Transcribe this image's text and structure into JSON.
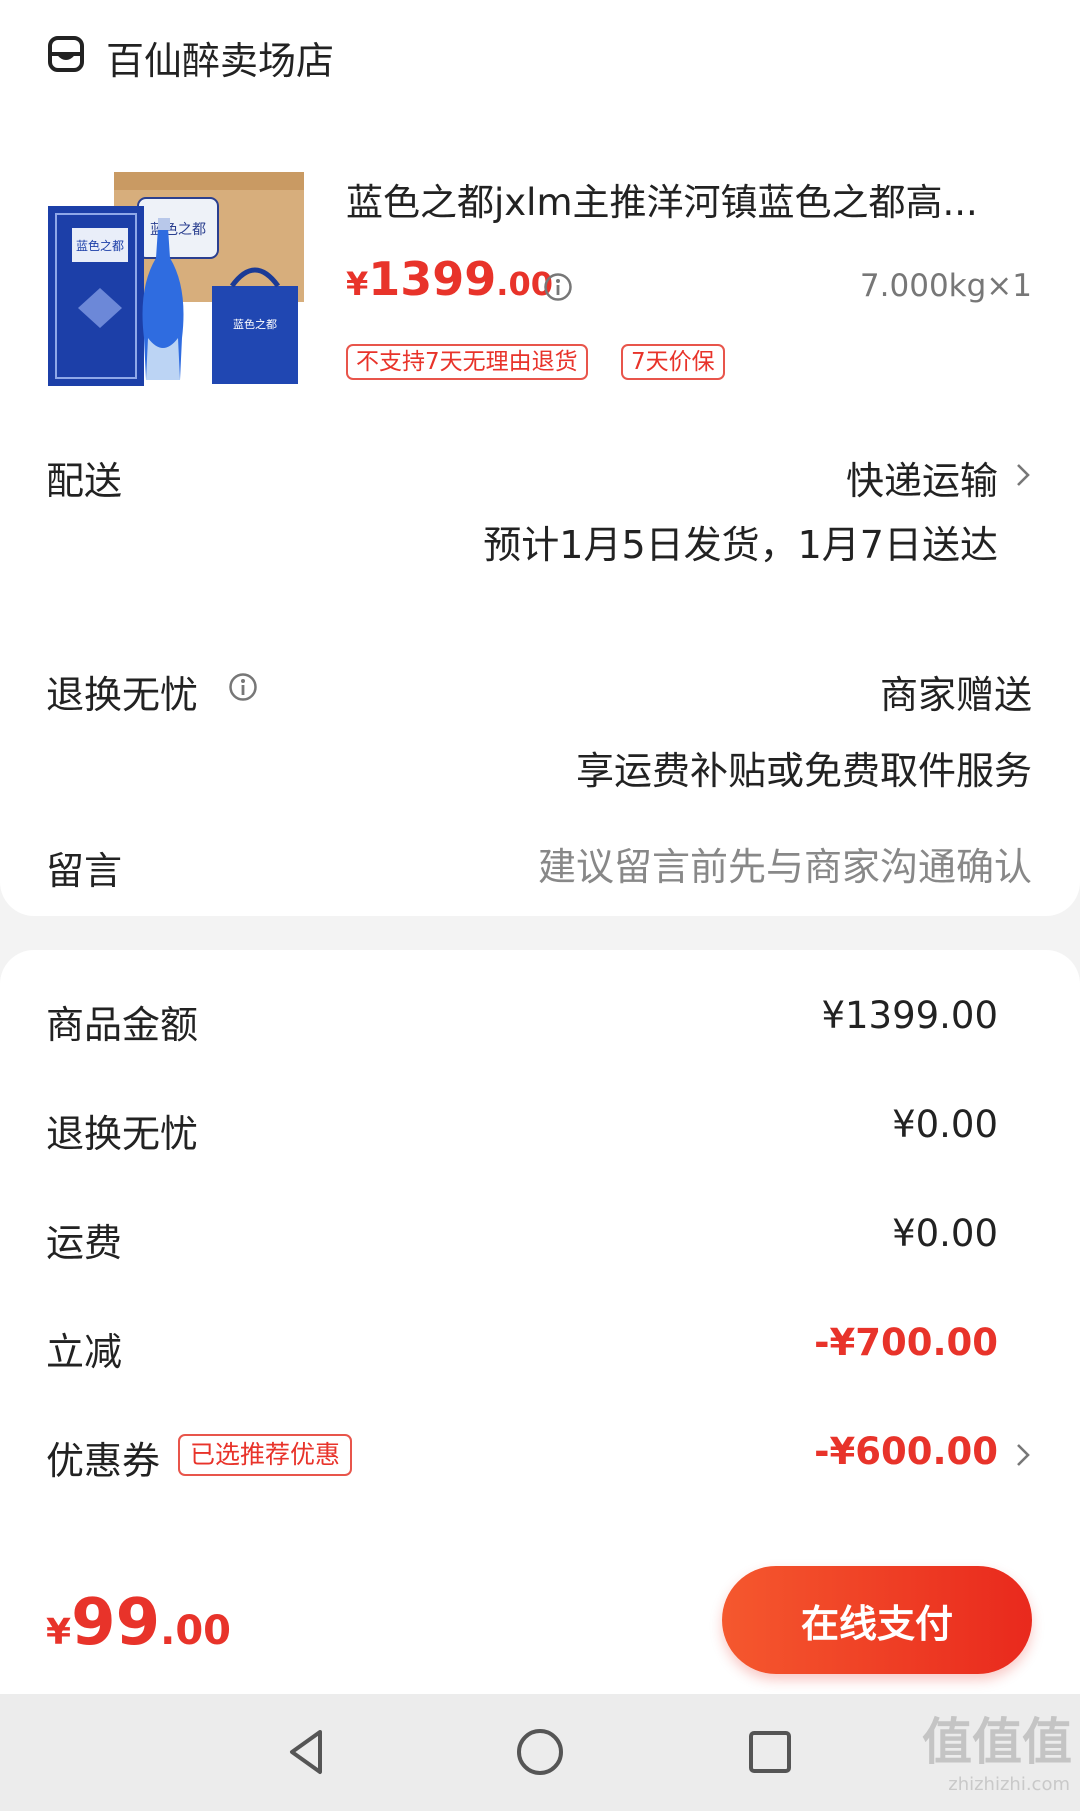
{
  "store": {
    "name": "百仙醉卖场店",
    "icon": "store-icon"
  },
  "product": {
    "title": "蓝色之都jxlm主推洋河镇蓝色之都高...",
    "price_currency": "¥",
    "price_int": "1399",
    "price_dec": ".00",
    "quantity": "7.000kg×1",
    "tags": [
      "不支持7天无理由退货",
      "7天价保"
    ],
    "image_labels": [
      "蓝色之都",
      "蓝色之都",
      "蓝色之都"
    ]
  },
  "delivery": {
    "label": "配送",
    "method": "快递运输",
    "estimate": "预计1月5日发货，1月7日送达"
  },
  "returns": {
    "label": "退换无忧",
    "value": "商家赠送",
    "detail": "享运费补贴或免费取件服务"
  },
  "message": {
    "label": "留言",
    "placeholder": "建议留言前先与商家沟通确认"
  },
  "costs": {
    "rows": [
      {
        "label": "商品金额",
        "value": "¥1399.00"
      },
      {
        "label": "退换无忧",
        "value": "¥0.00"
      },
      {
        "label": "运费",
        "value": "¥0.00"
      },
      {
        "label": "立减",
        "value": "-¥700.00"
      },
      {
        "label": "优惠券",
        "value": "-¥600.00",
        "tag": "已选推荐优惠"
      }
    ]
  },
  "footer": {
    "total_currency": "¥",
    "total_int": "99",
    "total_dec": ".00",
    "pay_label": "在线支付"
  },
  "watermark": {
    "main": "值值值",
    "sub": "zhizhizhi.com"
  },
  "colors": {
    "accent": "#e8332a",
    "button_start": "#f5582e",
    "button_end": "#e9291d"
  }
}
